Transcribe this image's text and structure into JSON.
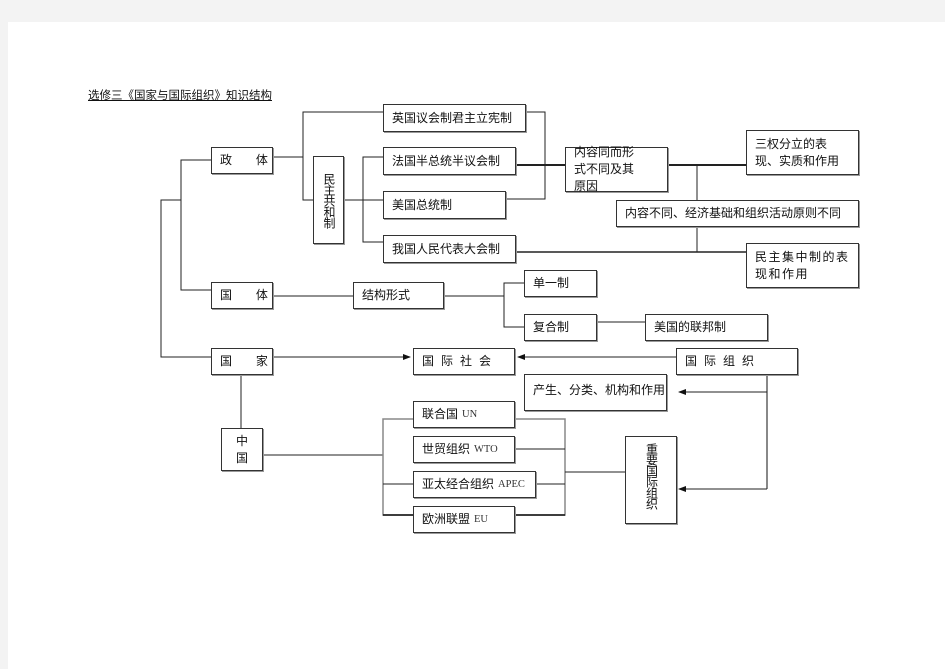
{
  "title": "选修三《国家与国际组织》知识结构",
  "nodes": {
    "zhengti": "政 体",
    "minzhu_gonghe": "民主共和制",
    "uk": "英国议会制君主立宪制",
    "france": "法国半总统半议会制",
    "usa": "美国总统制",
    "china_npc": "我国人民代表大会制",
    "same_content": "内容同而形式不同及其原因",
    "separation": "三权分立的表现、实质和作用",
    "diff_content": "内容不同、经济基础和组织活动原则不同",
    "democratic_centralism": "民主集中制的表现和作用",
    "guoti": "国 体",
    "structure": "结构形式",
    "unitary": "单一制",
    "compound": "复合制",
    "us_federal": "美国的联邦制",
    "state": "国 家",
    "intl_society": "国际社会",
    "intl_org": "国际组织",
    "origin": "产生、分类、机构和作用",
    "china": "中国",
    "important_orgs": "重要国际组织",
    "un": {
      "cn": "联合国",
      "en": "UN"
    },
    "wto": {
      "cn": "世贸组织",
      "en": "WTO"
    },
    "apec": {
      "cn": "亚太经合组织",
      "en": "APEC"
    },
    "eu": {
      "cn": "欧洲联盟",
      "en": "EU"
    }
  }
}
